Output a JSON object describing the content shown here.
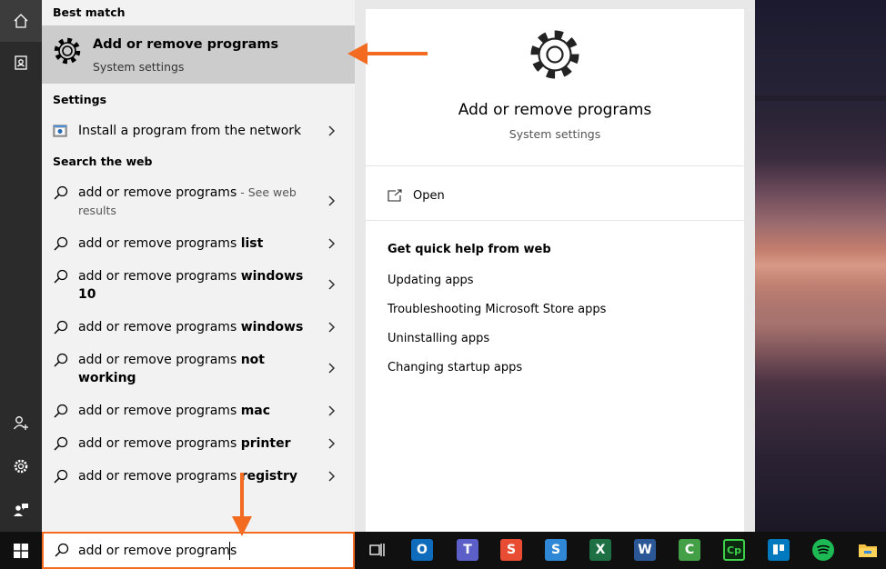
{
  "search": {
    "query": "add or remove programs"
  },
  "results": {
    "best_match_header": "Best match",
    "best_match_title": "Add or remove programs",
    "best_match_subtitle": "System settings",
    "settings_header": "Settings",
    "settings_item": "Install a program from the network",
    "web_header": "Search the web",
    "web_items": [
      {
        "plain": "add or remove programs",
        "bold": "",
        "suffix": " - See web",
        "suffix2": "results"
      },
      {
        "plain": "add or remove programs ",
        "bold": "list"
      },
      {
        "plain": "add or remove programs ",
        "bold": "windows",
        "bold2": "10"
      },
      {
        "plain": "add or remove programs ",
        "bold": "windows"
      },
      {
        "plain": "add or remove programs ",
        "bold": "not",
        "bold2": "working"
      },
      {
        "plain": "add or remove programs ",
        "bold": "mac"
      },
      {
        "plain": "add or remove programs ",
        "bold": "printer"
      },
      {
        "plain": "add or remove programs ",
        "bold": "registry"
      }
    ]
  },
  "preview": {
    "title": "Add or remove programs",
    "subtitle": "System settings",
    "open_label": "Open",
    "quick_help_header": "Get quick help from web",
    "quick_help_links": [
      "Updating apps",
      "Troubleshooting Microsoft Store apps",
      "Uninstalling apps",
      "Changing startup apps"
    ]
  },
  "taskbar": {
    "apps": [
      "task-view",
      "outlook",
      "teams",
      "snagit",
      "snagit-editor",
      "excel",
      "word",
      "camtasia",
      "camtasia-cp",
      "trello",
      "spotify",
      "file-explorer"
    ]
  },
  "colors": {
    "accent_orange": "#f26b21",
    "best_match_bg": "#cccccc",
    "rail_bg": "#2b2b2b",
    "taskbar_bg": "#101010"
  }
}
